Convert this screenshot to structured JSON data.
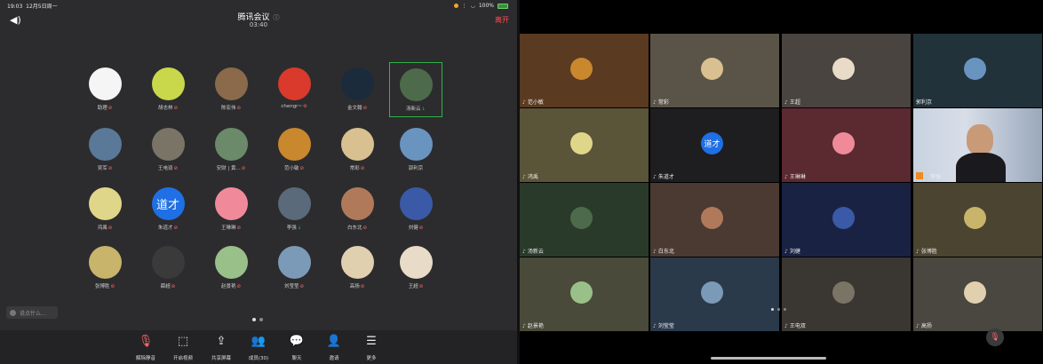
{
  "status": {
    "time": "19:03",
    "date": "12月5日周一",
    "battery": "100%"
  },
  "meeting": {
    "title": "腾讯会议",
    "time": "03:40",
    "leave": "离开"
  },
  "colors": {
    "speaking_border": "#2fb34a",
    "leave": "#ff4d4f",
    "muted": "#ff6b6b",
    "host_badge": "#f08a24"
  },
  "participants": [
    {
      "name": "助理",
      "mic": "muted",
      "avatar": "#f5f5f5"
    },
    {
      "name": "胡志林",
      "mic": "muted",
      "avatar": "#c8d84a"
    },
    {
      "name": "陈宏伟",
      "mic": "muted",
      "avatar": "#8a6a4a"
    },
    {
      "name": "chengr~",
      "mic": "muted",
      "avatar": "#d93a2b"
    },
    {
      "name": "金文翰",
      "mic": "muted",
      "avatar": "#1b2b3b"
    },
    {
      "name": "汤新云",
      "mic": "on",
      "avatar": "#4d6b4a",
      "speaking": true
    },
    {
      "name": "吴军",
      "mic": "muted",
      "avatar": "#5a7898"
    },
    {
      "name": "王电双",
      "mic": "muted",
      "avatar": "#7a7466"
    },
    {
      "name": "安财 | 黄...",
      "mic": "muted",
      "avatar": "#6a8a6a"
    },
    {
      "name": "范小敏",
      "mic": "muted",
      "avatar": "#c9872e"
    },
    {
      "name": "常彩",
      "mic": "muted",
      "avatar": "#d9c090"
    },
    {
      "name": "郭利京",
      "mic": "none",
      "avatar": "#6a94c0"
    },
    {
      "name": "鸿禹",
      "mic": "muted",
      "avatar": "#e0d68a"
    },
    {
      "name": "朱道才",
      "mic": "muted",
      "avatar": "#1f6fe5",
      "text": "道才"
    },
    {
      "name": "王琳琳",
      "mic": "muted",
      "avatar": "#f08a9a"
    },
    {
      "name": "李强",
      "mic": "on",
      "avatar": "#5a6a7a"
    },
    {
      "name": "白东北",
      "mic": "muted",
      "avatar": "#b07a5a"
    },
    {
      "name": "刘健",
      "mic": "muted",
      "avatar": "#3a5aa8"
    },
    {
      "name": "张博胜",
      "mic": "muted",
      "avatar": "#c8b46a"
    },
    {
      "name": "薛超",
      "mic": "muted",
      "avatar": "#3a3a3a"
    },
    {
      "name": "赵景艳",
      "mic": "muted",
      "avatar": "#9ac08a"
    },
    {
      "name": "刘莹莹",
      "mic": "muted",
      "avatar": "#7a9ab8"
    },
    {
      "name": "高扬",
      "mic": "muted",
      "avatar": "#e0d0b0"
    },
    {
      "name": "王超",
      "mic": "muted",
      "avatar": "#e8dcc8"
    }
  ],
  "chat_placeholder": "说点什么...",
  "toolbar": [
    {
      "label": "解除静音",
      "icon": "mic-muted-icon",
      "glyph": "🎙"
    },
    {
      "label": "开启视频",
      "icon": "video-off-icon",
      "glyph": "⬚"
    },
    {
      "label": "共享屏幕",
      "icon": "share-screen-icon",
      "glyph": "⇪"
    },
    {
      "label": "成员(30)",
      "icon": "members-icon",
      "glyph": "👥"
    },
    {
      "label": "聊天",
      "icon": "chat-icon",
      "glyph": "💬"
    },
    {
      "label": "邀请",
      "icon": "invite-icon",
      "glyph": "👤"
    },
    {
      "label": "更多",
      "icon": "more-icon",
      "glyph": "☰"
    }
  ],
  "tiles": [
    {
      "name": "范小敏",
      "bg": "#5a3a20",
      "avatar": "#c9872e"
    },
    {
      "name": "常彩",
      "bg": "#5a5448",
      "avatar": "#d9c090"
    },
    {
      "name": "王超",
      "bg": "#4a4440",
      "avatar": "#e8dcc8"
    },
    {
      "name": "郭利京",
      "bg": "#22323a",
      "avatar": "#6a94c0",
      "mic": "none"
    },
    {
      "name": "鸿禹",
      "bg": "#5a5438",
      "avatar": "#e0d68a"
    },
    {
      "name": "朱道才",
      "bg": "#1e1e20",
      "avatar": "#1f6fe5",
      "text": "道才"
    },
    {
      "name": "王琳琳",
      "bg": "#5a2a30",
      "avatar": "#f08a9a"
    },
    {
      "name": "李强",
      "bg": "#b8c4d4",
      "video": true,
      "host": true
    },
    {
      "name": "汤新云",
      "bg": "#2a3a2a",
      "avatar": "#4d6b4a"
    },
    {
      "name": "白东北",
      "bg": "#4a3a32",
      "avatar": "#b07a5a"
    },
    {
      "name": "刘健",
      "bg": "#1a2244",
      "avatar": "#3a5aa8"
    },
    {
      "name": "张博胜",
      "bg": "#4a4430",
      "avatar": "#c8b46a"
    },
    {
      "name": "赵景艳",
      "bg": "#4a4a3a",
      "avatar": "#9ac08a"
    },
    {
      "name": "刘莹莹",
      "bg": "#2a3a4a",
      "avatar": "#7a9ab8"
    },
    {
      "name": "王电双",
      "bg": "#3a3632",
      "avatar": "#7a7466"
    },
    {
      "name": "高扬",
      "bg": "#4a4640",
      "avatar": "#e0d0b0"
    }
  ]
}
